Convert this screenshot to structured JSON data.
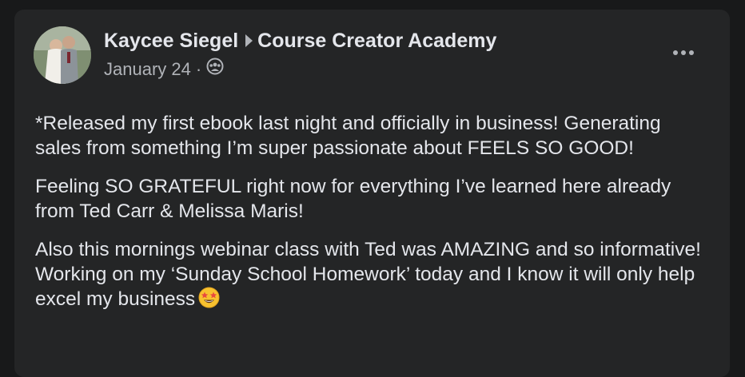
{
  "post": {
    "author": "Kaycee Siegel",
    "group": "Course Creator Academy",
    "date": "January 24",
    "separator": "·",
    "privacy_icon": "group-members-icon",
    "more_icon": "more-options-icon",
    "paragraphs": [
      "*Released my first ebook last night and officially in business! Generating sales from something I’m super passionate about FEELS SO GOOD!",
      "Feeling SO GRATEFUL right now for everything I’ve learned here already from Ted Carr & Melissa Maris!",
      "Also this mornings webinar class with Ted was AMAZING and so informative! Working on my ‘Sunday School Homework’ today and I know it will only help excel my business"
    ],
    "trailing_emoji": "star-struck-emoji"
  }
}
